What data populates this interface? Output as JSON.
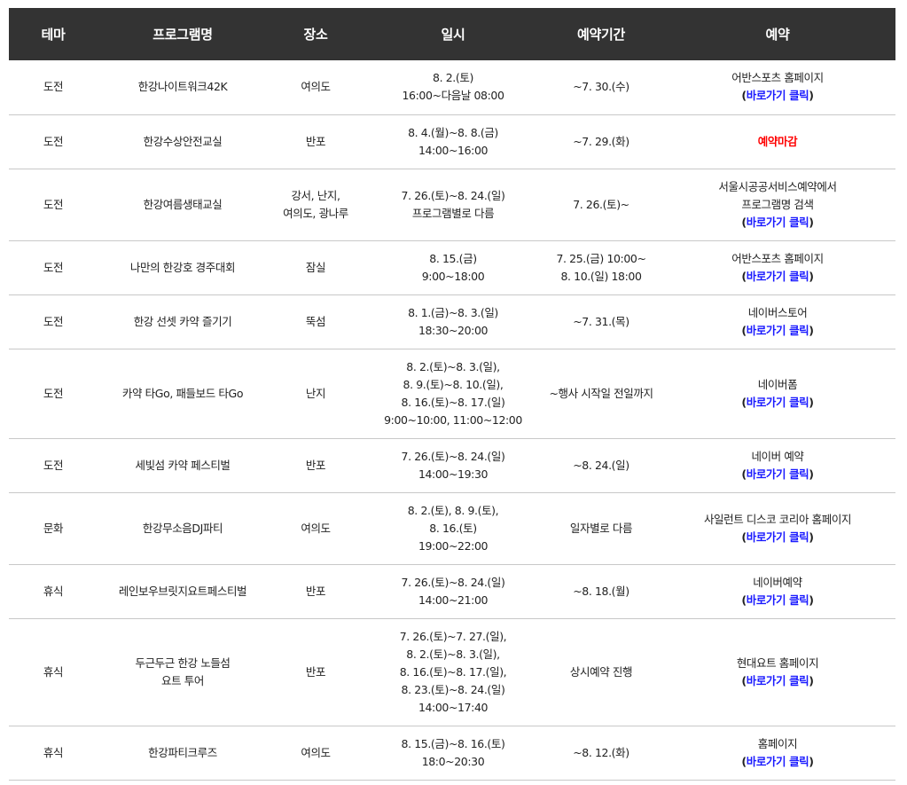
{
  "headers": [
    "테마",
    "프로그램명",
    "장소",
    "일시",
    "예약기간",
    "예약"
  ],
  "link_label": "바로가기 클릭",
  "colors": {
    "header_bg": "#333333",
    "link": "#1a1aff",
    "closed": "#ff0000",
    "row_border": "#c8c8c8"
  },
  "rows": [
    {
      "theme": "도전",
      "program": [
        "한강나이트워크42K"
      ],
      "place": [
        "여의도"
      ],
      "datetime": [
        "8. 2.(토)",
        "16:00~다음날 08:00"
      ],
      "period": [
        "~7. 30.(수)"
      ],
      "booking": {
        "text": [
          "어반스포츠 홈페이지"
        ],
        "link": true,
        "closed": false
      }
    },
    {
      "theme": "도전",
      "program": [
        "한강수상안전교실"
      ],
      "place": [
        "반포"
      ],
      "datetime": [
        "8. 4.(월)~8. 8.(금)",
        "14:00~16:00"
      ],
      "period": [
        "~7. 29.(화)"
      ],
      "booking": {
        "text": [
          "예약마감"
        ],
        "link": false,
        "closed": true
      }
    },
    {
      "theme": "도전",
      "program": [
        "한강여름생태교실"
      ],
      "place": [
        "강서, 난지,",
        "여의도, 광나루"
      ],
      "datetime": [
        "7. 26.(토)~8. 24.(일)",
        "프로그램별로 다름"
      ],
      "period": [
        "7. 26.(토)~"
      ],
      "booking": {
        "text": [
          "서울시공공서비스예약에서",
          "프로그램명 검색"
        ],
        "link": true,
        "closed": false
      }
    },
    {
      "theme": "도전",
      "program": [
        "나만의 한강호 경주대회"
      ],
      "place": [
        "잠실"
      ],
      "datetime": [
        "8. 15.(금)",
        "9:00~18:00"
      ],
      "period": [
        "7. 25.(금) 10:00~",
        "8. 10.(일) 18:00"
      ],
      "booking": {
        "text": [
          "어반스포츠 홈페이지"
        ],
        "link": true,
        "closed": false
      }
    },
    {
      "theme": "도전",
      "program": [
        "한강 선셋 카약 즐기기"
      ],
      "place": [
        "뚝섬"
      ],
      "datetime": [
        "8. 1.(금)~8. 3.(일)",
        "18:30~20:00"
      ],
      "period": [
        "~7. 31.(목)"
      ],
      "booking": {
        "text": [
          "네이버스토어"
        ],
        "link": true,
        "closed": false
      }
    },
    {
      "theme": "도전",
      "program": [
        "카약 타Go, 패들보드 타Go"
      ],
      "place": [
        "난지"
      ],
      "datetime": [
        "8. 2.(토)~8. 3.(일),",
        "8. 9.(토)~8. 10.(일),",
        "8. 16.(토)~8. 17.(일)",
        "9:00~10:00, 11:00~12:00"
      ],
      "period": [
        "~행사 시작일 전일까지"
      ],
      "booking": {
        "text": [
          "네이버폼"
        ],
        "link": true,
        "closed": false
      }
    },
    {
      "theme": "도전",
      "program": [
        "세빛섬 카약 페스티벌"
      ],
      "place": [
        "반포"
      ],
      "datetime": [
        "7. 26.(토)~8. 24.(일)",
        "14:00~19:30"
      ],
      "period": [
        "~8. 24.(일)"
      ],
      "booking": {
        "text": [
          "네이버 예약"
        ],
        "link": true,
        "closed": false
      }
    },
    {
      "theme": "문화",
      "program": [
        "한강무소음DJ파티"
      ],
      "place": [
        "여의도"
      ],
      "datetime": [
        "8. 2.(토), 8. 9.(토),",
        "8. 16.(토)",
        "19:00~22:00"
      ],
      "period": [
        "일자별로 다름"
      ],
      "booking": {
        "text": [
          "사일런트 디스코 코리아 홈페이지"
        ],
        "link": true,
        "closed": false
      }
    },
    {
      "theme": "휴식",
      "program": [
        "레인보우브릿지요트페스티벌"
      ],
      "place": [
        "반포"
      ],
      "datetime": [
        "7. 26.(토)~8. 24.(일)",
        "14:00~21:00"
      ],
      "period": [
        "~8. 18.(월)"
      ],
      "booking": {
        "text": [
          "네이버예약"
        ],
        "link": true,
        "closed": false
      }
    },
    {
      "theme": "휴식",
      "program": [
        "두근두근 한강 노들섬",
        "요트 투어"
      ],
      "place": [
        "반포"
      ],
      "datetime": [
        "7. 26.(토)~7. 27.(일),",
        "8. 2.(토)~8. 3.(일),",
        "8. 16.(토)~8. 17.(일),",
        "8. 23.(토)~8. 24.(일)",
        "14:00~17:40"
      ],
      "period": [
        "상시예약 진행"
      ],
      "booking": {
        "text": [
          "현대요트 홈페이지"
        ],
        "link": true,
        "closed": false
      }
    },
    {
      "theme": "휴식",
      "program": [
        "한강파티크루즈"
      ],
      "place": [
        "여의도"
      ],
      "datetime": [
        "8. 15.(금)~8. 16.(토)",
        "18:0~20:30"
      ],
      "period": [
        "~8. 12.(화)"
      ],
      "booking": {
        "text": [
          "홈페이지"
        ],
        "link": true,
        "closed": false
      }
    }
  ]
}
